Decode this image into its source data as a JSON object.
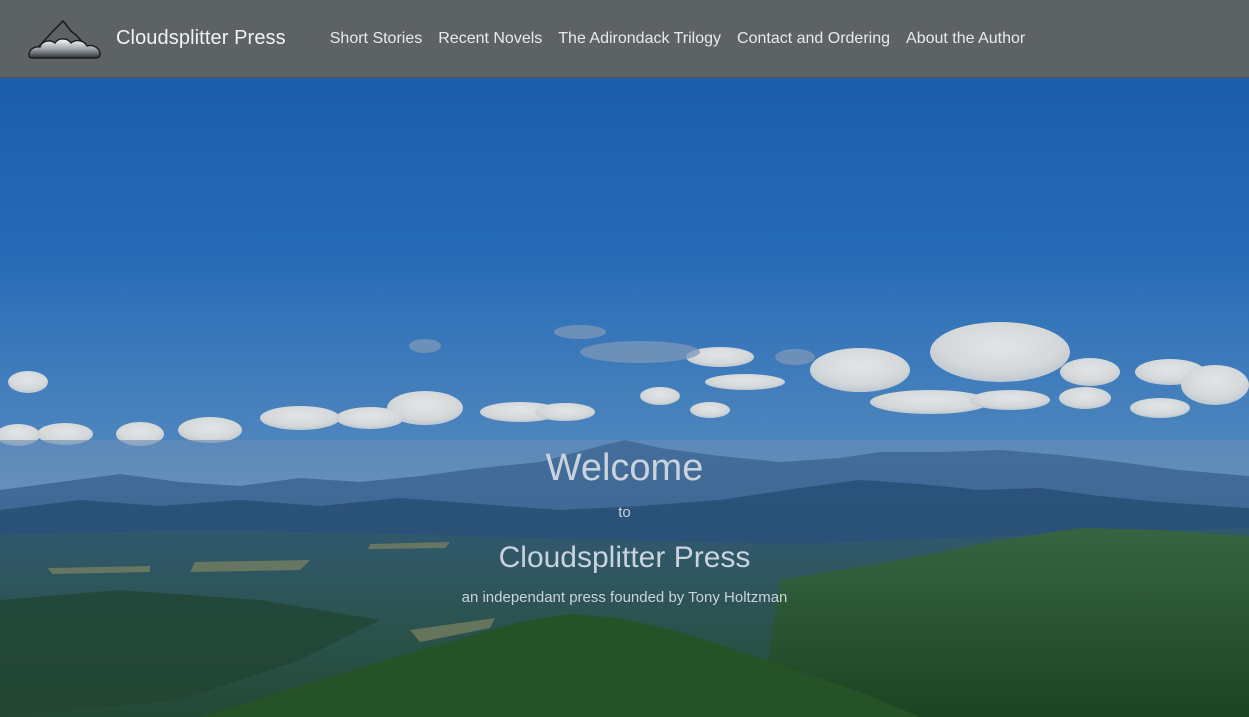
{
  "brand": {
    "name": "Cloudsplitter Press",
    "logo_icon": "mountain-cloud-icon"
  },
  "nav": {
    "items": [
      {
        "label": "Short Stories"
      },
      {
        "label": "Recent Novels"
      },
      {
        "label": "The Adirondack Trilogy"
      },
      {
        "label": "Contact and Ordering"
      },
      {
        "label": "About the Author"
      }
    ]
  },
  "hero": {
    "welcome": "Welcome",
    "to": "to",
    "title": "Cloudsplitter Press",
    "subtitle": "an independant press founded by Tony Holtzman",
    "background": "adirondack-mountain-landscape-photo"
  },
  "colors": {
    "navbar": "#5d6265",
    "nav_text": "#e9e9e9",
    "hero_text": "#c9d3dd",
    "sky_top": "#1f66b8",
    "forest": "#2e5a3a"
  }
}
